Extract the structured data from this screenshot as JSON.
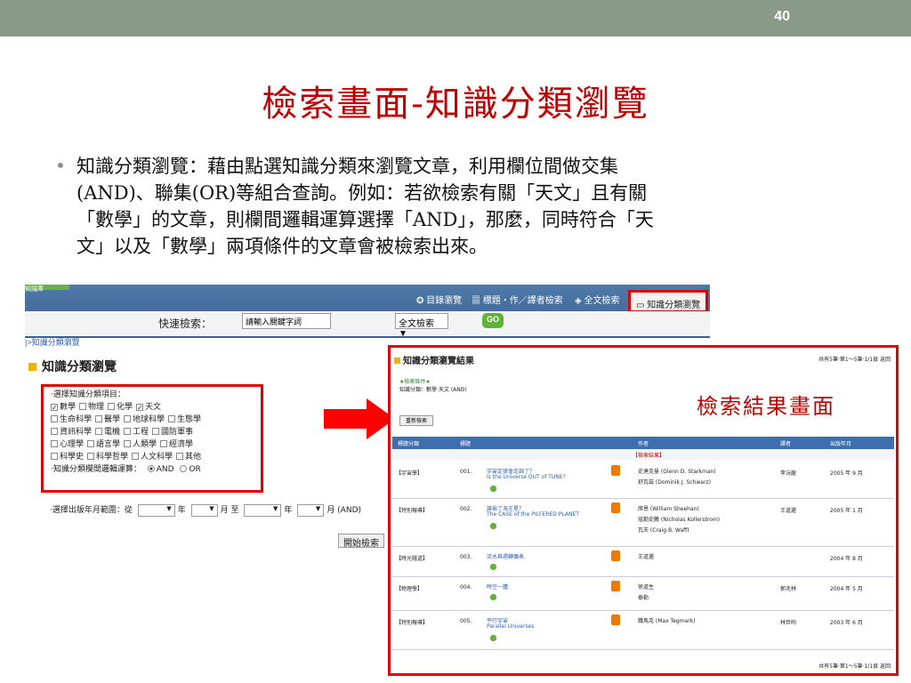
{
  "slide": {
    "page_number": "40",
    "title": "檢索畫面-知識分類瀏覽",
    "body_lines": [
      "知識分類瀏覽：藉由點選知識分類來瀏覽文章，利用欄位間做交集",
      "(AND)、聯集(OR)等組合查詢。例如：若欲檢索有關「天文」且有關",
      "「數學」的文章，則欄間邏輯運算選擇「AND」，那麼，同時符合「天",
      "文」以及「數學」兩項條件的文章會被檢索出來。"
    ]
  },
  "site": {
    "logo_text": "知識庫",
    "nav": [
      "目錄瀏覽",
      "標題‧作／譯者檢索",
      "全文檢索"
    ],
    "nav_active": "知識分類瀏覽",
    "quick_label": "快速檢索：",
    "quick_placeholder": "請輸入關鍵字詞",
    "quick_select": "全文檢索 ▼",
    "go_label": "GO",
    "breadcrumb": "|>知識分類瀏覽",
    "section_title": "知識分類瀏覽"
  },
  "categories": {
    "heading": "‧選擇知識分類項目：",
    "rows": [
      [
        {
          "label": "數學",
          "checked": true
        },
        {
          "label": "物理",
          "checked": false
        },
        {
          "label": "化學",
          "checked": false
        },
        {
          "label": "天文",
          "checked": true
        }
      ],
      [
        {
          "label": "生命科學",
          "checked": false
        },
        {
          "label": "醫學",
          "checked": false
        },
        {
          "label": "地球科學",
          "checked": false
        },
        {
          "label": "生態學",
          "checked": false
        }
      ],
      [
        {
          "label": "資訊科學",
          "checked": false
        },
        {
          "label": "電機",
          "checked": false
        },
        {
          "label": "工程",
          "checked": false
        },
        {
          "label": "國防軍事",
          "checked": false
        }
      ],
      [
        {
          "label": "心理學",
          "checked": false
        },
        {
          "label": "語言學",
          "checked": false
        },
        {
          "label": "人類學",
          "checked": false
        },
        {
          "label": "經濟學",
          "checked": false
        }
      ],
      [
        {
          "label": "科學史",
          "checked": false
        },
        {
          "label": "科學哲學",
          "checked": false
        },
        {
          "label": "人文科學",
          "checked": false
        },
        {
          "label": "其他",
          "checked": false
        }
      ]
    ],
    "logic_label": "‧知識分類欄間邏輯運算：",
    "logic_and": "AND",
    "logic_or": "OR"
  },
  "date_range": {
    "label": "‧選擇出版年月範圍：從",
    "year": "年",
    "month": "月",
    "to": "至",
    "month_and": "月 (AND)",
    "arrow": "▼"
  },
  "start_button": "開始檢索",
  "results": {
    "title": "知識分類瀏覽結果",
    "summary": "共有5筆‧第1～5筆‧1/1頁  返回",
    "criteria_title": "★檢索條件★",
    "criteria": "知識分類：數學‧天文 (AND)",
    "renew_button": "重新檢索",
    "overlay_label": "檢索結果畫面",
    "columns": [
      "標題分類",
      "標題",
      "作者",
      "譯者",
      "出版年月"
    ],
    "subhead": "【檢索結果】",
    "rows": [
      {
        "cat": "【宇宙學】",
        "no": "001.",
        "title": "宇宙定律會走調了？",
        "title_en": "Is the Universe OUT of TUNE?",
        "authors": [
          "史達克曼 (Glenn D. Starkman)",
          "舒瓦茲 (Dominik J. Schwarz)"
        ],
        "translator": "李沅龍",
        "date": "2005 年 9 月"
      },
      {
        "cat": "【特別報導】",
        "no": "002.",
        "title": "誰偷了海王星？",
        "title_en": "The CASE of the PILFERED PLANET",
        "authors": [
          "席恩 (William Sheehan)",
          "寇勒史騰 (Nicholas Kollerstrom)",
          "瓦夫 (Craig B. Waff)"
        ],
        "translator": "王道還",
        "date": "2005 年 1 月"
      },
      {
        "cat": "【時光隧道】",
        "no": "003.",
        "title": "流水與週轉儀表",
        "title_en": "",
        "authors": [
          "王道還"
        ],
        "translator": "",
        "date": "2004 年 8 月"
      },
      {
        "cat": "【物理學】",
        "no": "004.",
        "title": "時空一體",
        "title_en": "",
        "authors": [
          "徐道生",
          "泰勒"
        ],
        "translator": "郭兆林",
        "date": "2004 年 5 月"
      },
      {
        "cat": "【特別報導】",
        "no": "005.",
        "title": "平行宇宙",
        "title_en": "Parallel Universes",
        "authors": [
          "鐵馬克 (Max Tegmark)"
        ],
        "translator": "林世昀",
        "date": "2003 年 6 月"
      }
    ]
  },
  "colors": {
    "title_red": "#c00000",
    "top_bar": "#8a9a88",
    "highlight_border": "#e00000",
    "table_header": "#3f6eb0"
  }
}
